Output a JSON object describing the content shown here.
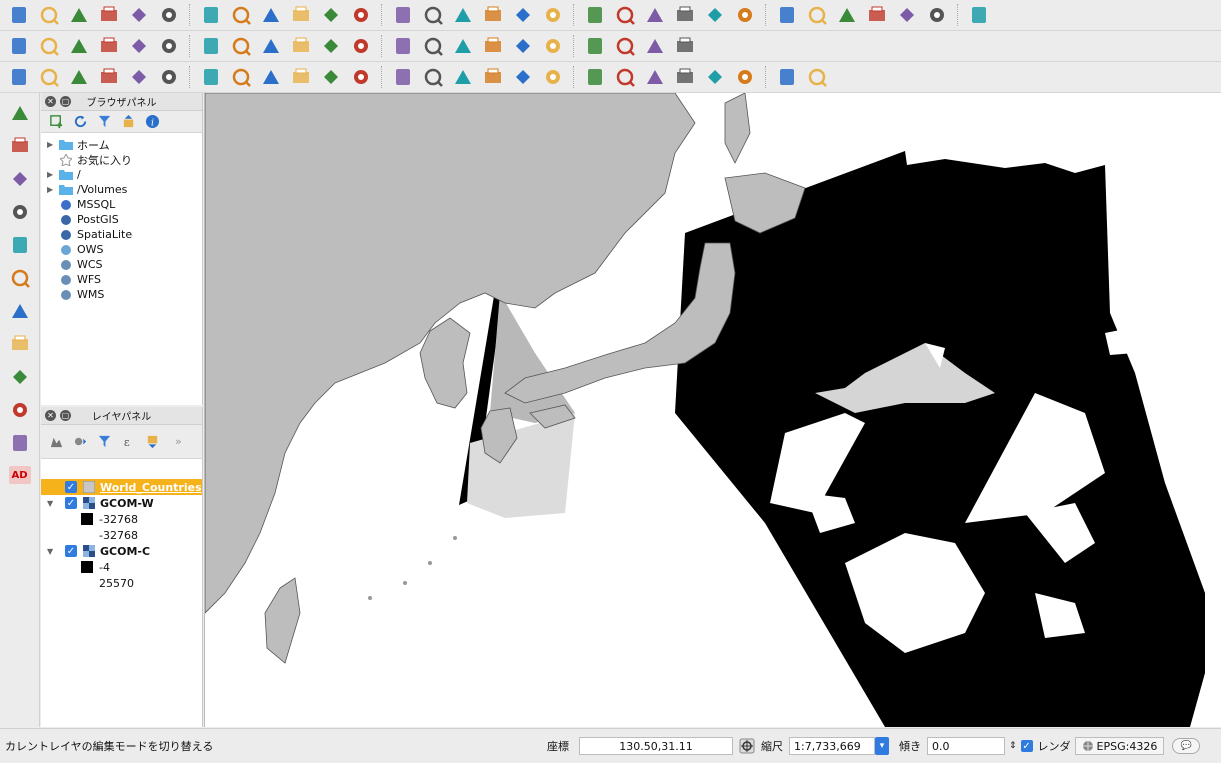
{
  "toolbar1": {
    "icons": [
      "new-project-icon",
      "open-project-icon",
      "save-project-icon",
      "save-as-icon",
      "new-print-layout-icon",
      "layout-manager-icon",
      "pan-icon",
      "pan-to-selection-icon",
      "zoom-in-icon",
      "zoom-out-icon",
      "zoom-native-icon",
      "zoom-full-icon",
      "zoom-to-selection-icon",
      "zoom-to-layer-icon",
      "zoom-last-icon",
      "zoom-next-icon",
      "refresh-icon",
      "identify-icon",
      "settings-gear-icon",
      "select-features-icon",
      "select-by-expression-icon",
      "deselect-icon",
      "attribute-table-icon",
      "statistics-icon",
      "sum-icon",
      "measure-icon",
      "map-tips-icon",
      "annotation-icon",
      "new-bookmark-icon",
      "text-annotation-icon",
      "help-icon"
    ]
  },
  "toolbar2": {
    "icons": [
      "current-edits-icon",
      "toggle-editing-icon",
      "save-edits-icon",
      "add-feature-icon",
      "node-tool-icon",
      "move-feature-icon",
      "modify-attributes-icon",
      "delete-selected-icon",
      "cut-features-icon",
      "copy-features-icon",
      "paste-features-icon",
      "label-abc-icon",
      "label-pin-icon",
      "label-show-hide-icon",
      "label-move-icon",
      "label-rotate-icon",
      "label-change-icon",
      "label-diagram-icon",
      "csw-icon",
      "python-icon",
      "expression-icon",
      "qr-icon"
    ]
  },
  "toolbar3": {
    "icons": [
      "digitize-icon",
      "undo-icon",
      "redo-icon",
      "redo-alt-icon",
      "rotate-feature-icon",
      "simplify-icon",
      "add-ring-icon",
      "add-part-icon",
      "fill-ring-icon",
      "delete-ring-icon",
      "delete-part-icon",
      "reshape-icon",
      "offset-curve-icon",
      "split-features-icon",
      "split-parts-icon",
      "merge-features-icon",
      "merge-attributes-icon",
      "rotate-point-symbols-icon",
      "snapping-icon",
      "tracing-icon",
      "vertex-tool-icon",
      "topology-icon",
      "add-point-icon",
      "add-line-icon",
      "intersect-icon",
      "grid-icon"
    ]
  },
  "left_tools": {
    "icons": [
      "add-vector-layer-icon",
      "add-raster-layer-icon",
      "add-postgis-layer-icon",
      "add-spatialite-layer-icon",
      "add-mssql-layer-icon",
      "add-wms-layer-icon",
      "add-wcs-layer-icon",
      "add-wfs-layer-icon",
      "add-delimited-text-icon",
      "add-virtual-layer-icon",
      "new-shapefile-icon"
    ],
    "badge": "AD"
  },
  "browser_panel": {
    "title": "ブラウザパネル",
    "items": [
      {
        "label": "ホーム",
        "icon": "folder-icon",
        "expandable": true
      },
      {
        "label": "お気に入り",
        "icon": "star-icon",
        "expandable": false
      },
      {
        "label": "/",
        "icon": "folder-icon",
        "expandable": true
      },
      {
        "label": "/Volumes",
        "icon": "folder-icon",
        "expandable": true
      },
      {
        "label": "MSSQL",
        "icon": "mssql-icon",
        "expandable": false
      },
      {
        "label": "PostGIS",
        "icon": "postgis-elephant-icon",
        "expandable": false
      },
      {
        "label": "SpatiaLite",
        "icon": "feather-icon",
        "expandable": false
      },
      {
        "label": "OWS",
        "icon": "globe-icon",
        "expandable": false
      },
      {
        "label": "WCS",
        "icon": "wcs-globe-icon",
        "expandable": false
      },
      {
        "label": "WFS",
        "icon": "wfs-globe-icon",
        "expandable": false
      },
      {
        "label": "WMS",
        "icon": "wms-globe-icon",
        "expandable": false
      }
    ]
  },
  "layer_panel": {
    "title": "レイヤパネル",
    "layers": [
      {
        "name": "World_Countries",
        "selected": true,
        "checked": true
      },
      {
        "name": "GCOM-W",
        "checked": true,
        "legend": [
          "-32768",
          "-32768"
        ]
      },
      {
        "name": "GCOM-C",
        "checked": true,
        "legend": [
          "-4",
          "25570"
        ]
      }
    ]
  },
  "statusbar": {
    "message": "カレントレイヤの編集モードを切り替える",
    "coord_label": "座標",
    "coord_value": "130.50,31.11",
    "scale_label": "縮尺",
    "scale_value": "1:7,733,669",
    "rotation_label": "傾き",
    "rotation_value": "0.0",
    "render_label": "レンダ",
    "crs": "EPSG:4326"
  },
  "colors": {
    "selection": "#f6b21b",
    "land": "#bdbdbd",
    "raster": "#000000",
    "checkbox": "#2f7be0"
  }
}
